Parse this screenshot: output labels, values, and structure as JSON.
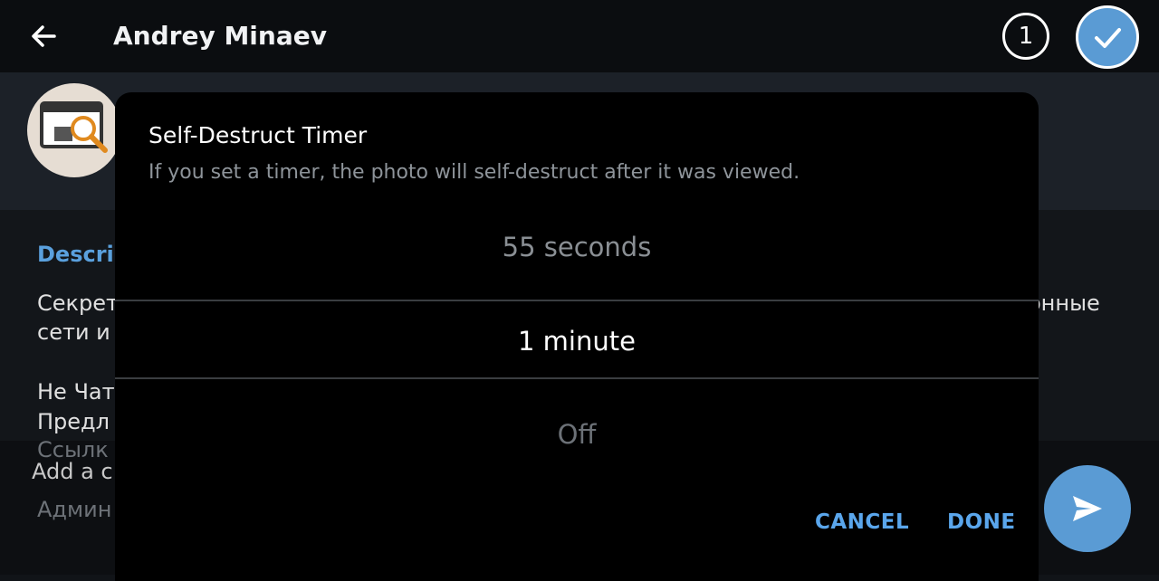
{
  "header": {
    "title": "Andrey Minaev",
    "selected_count": "1",
    "icons": {
      "back": "arrow-left-icon",
      "confirm": "check-icon"
    }
  },
  "background": {
    "description_label": "Descrip",
    "line1_left": "Секрет",
    "line1_right": "онные",
    "line2": "сети и",
    "line3": "Не Чат",
    "line4": "Предл",
    "line5": "Ссылк",
    "caption_placeholder": "Add a c",
    "line6": "Админ"
  },
  "dialog": {
    "title": "Self-Destruct Timer",
    "subtitle": "If you set a timer, the photo will self-destruct after it was viewed.",
    "options": {
      "previous": "55 seconds",
      "selected": "1 minute",
      "next": "Off"
    },
    "cancel_label": "CANCEL",
    "done_label": "DONE"
  },
  "colors": {
    "accent": "#5a9bd4",
    "dialog_bg": "#000000",
    "button_text": "#5aa6ec"
  }
}
